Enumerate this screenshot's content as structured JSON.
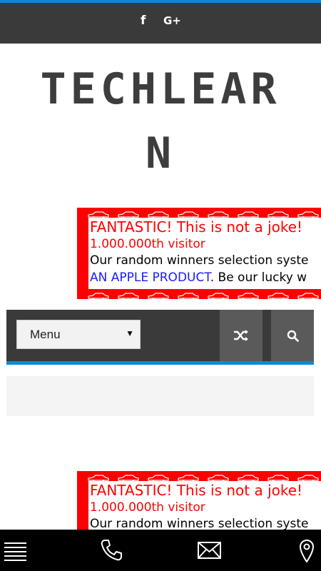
{
  "topbar": {
    "facebook_label": "f",
    "googleplus_label": "G+",
    "accent_color": "#0a8ad6"
  },
  "logo": {
    "line1": "TECHLEAR",
    "line2": "N"
  },
  "ad": {
    "headline": "FANTASTIC! This is not a joke!",
    "visitor": "1.000.000th visitor",
    "body": "Our random winners selection syste",
    "link": "AN APPLE PRODUCT",
    "body_after_link": ". Be our lucky w"
  },
  "ad2": {
    "headline": "FANTASTIC! This is not a joke!",
    "visitor": "1.000.000th visitor",
    "body": "Our random winners selection syste"
  },
  "navbar": {
    "menu_value": "Menu",
    "random_icon": "shuffle-icon",
    "search_icon": "search-icon"
  },
  "bottombar": {
    "icons": [
      "menu-icon",
      "phone-icon",
      "mail-icon",
      "location-icon"
    ]
  }
}
